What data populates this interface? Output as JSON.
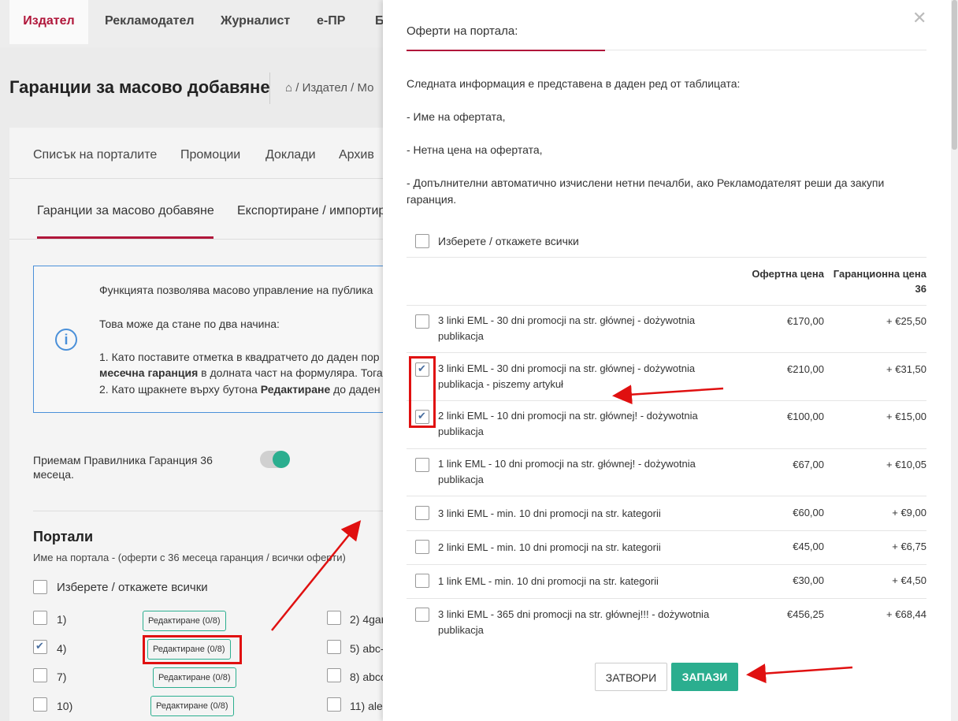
{
  "topnav": {
    "items": [
      "Издател",
      "Рекламодател",
      "Журналист",
      "е-ПР",
      "Б"
    ]
  },
  "page": {
    "title": "Гаранции за масово добавяне",
    "breadcrumb": [
      "Издател",
      "Мо"
    ]
  },
  "subnav": [
    "Списък на порталите",
    "Промоции",
    "Доклади",
    "Архив"
  ],
  "tabs": [
    "Гаранции за масово добавяне",
    "Експортиране / импортир"
  ],
  "info": {
    "line1": "Функцията позволява масово управление на публика",
    "line2": "Това може да стане по два начина:",
    "line3": "1. Като поставите отметка в квадратчето до даден пор",
    "line4_bold": "месечна гаранция",
    "line4_rest": " в долната част на формуляра. Тога",
    "line5_pre": "2. Като щракнете върху бутона ",
    "line5_bold": "Редактиране",
    "line5_rest": " до даден"
  },
  "terms": {
    "label_line1": "Приемам Правилника Гаранция 36",
    "label_line2": "месеца.",
    "enabled": true
  },
  "portals": {
    "heading": "Портали",
    "subheading": "Име на портала - (оферти с 36 месеца гаранция / всички оферти)",
    "select_all": "Изберете / откажете всички",
    "left": [
      {
        "label": "1)",
        "edit": "Редактиране (0/8)",
        "checked": false
      },
      {
        "label": "4)",
        "edit": "Редактиране (0/8)",
        "checked": true
      },
      {
        "label": "7)",
        "edit": "Редактиране (0/8)",
        "checked": false
      },
      {
        "label": "10)",
        "edit": "Редактиране (0/8)",
        "checked": false
      }
    ],
    "right": [
      {
        "label": "2) 4gar"
      },
      {
        "label": "5) abc-"
      },
      {
        "label": "8) abco"
      },
      {
        "label": "11) ale"
      }
    ]
  },
  "panel": {
    "title": "Оферти на портала:",
    "desc": "Следната информация е представена в даден ред от таблицата:",
    "bullet1": "- Име на офертата,",
    "bullet2": "- Нетна цена на офертата,",
    "bullet3a": "- Допълнителни автоматично изчислени нетни печалби, ако Рекламодателят реши да закупи",
    "bullet3b": "гаранция.",
    "select_all": "Изберете / откажете всички",
    "col_price": "Офертна цена",
    "col_guarantee_1": "Гаранционна цена",
    "col_guarantee_2": "36",
    "offers": [
      {
        "l1": "3 linki EML - 30 dni promocji na str. głównej - dożywotnia",
        "l2": "publikacja",
        "price": "€170,00",
        "gar": "+ €25,50",
        "checked": false
      },
      {
        "l1": "3 linki EML - 30 dni promocji na str. głównej - dożywotnia",
        "l2": "publikacja - piszemy artykuł",
        "price": "€210,00",
        "gar": "+ €31,50",
        "checked": true
      },
      {
        "l1": "2 linki EML - 10 dni promocji na str. głównej! - dożywotnia",
        "l2": "publikacja",
        "price": "€100,00",
        "gar": "+ €15,00",
        "checked": true
      },
      {
        "l1": "1 link EML - 10 dni promocji na str. głównej! - dożywotnia",
        "l2": "publikacja",
        "price": "€67,00",
        "gar": "+ €10,05",
        "checked": false
      },
      {
        "l1": "3 linki EML - min. 10 dni promocji na str. kategorii",
        "l2": "",
        "price": "€60,00",
        "gar": "+ €9,00",
        "checked": false
      },
      {
        "l1": "2 linki EML - min. 10 dni promocji na str. kategorii",
        "l2": "",
        "price": "€45,00",
        "gar": "+ €6,75",
        "checked": false
      },
      {
        "l1": "1 link EML - min. 10 dni promocji na str. kategorii",
        "l2": "",
        "price": "€30,00",
        "gar": "+ €4,50",
        "checked": false
      },
      {
        "l1": "3 linki EML - 365 dni promocji na str. głównej!!! - dożywotnia",
        "l2": "publikacja",
        "price": "€456,25",
        "gar": "+ €68,44",
        "checked": false
      }
    ],
    "close_btn": "ЗАТВОРИ",
    "save_btn": "ЗАПАЗИ"
  },
  "colors": {
    "brand": "#b0163a",
    "accent": "#2bae8f",
    "info": "#4a90d9",
    "annotation": "#e01010"
  }
}
